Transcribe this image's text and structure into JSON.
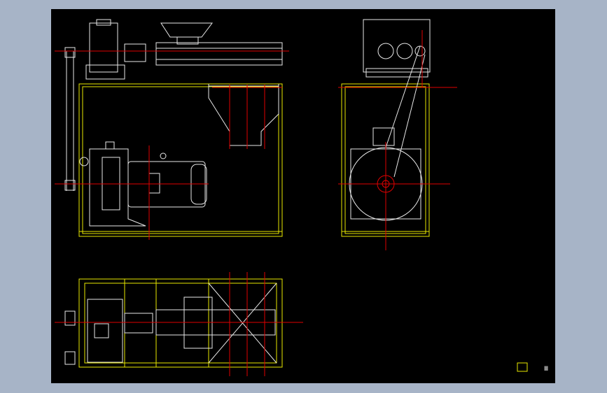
{
  "window": {
    "background_color": "#a7b4c7",
    "canvas_color": "#000000"
  },
  "colors": {
    "outline": "#e8e8e8",
    "frame": "#e8e800",
    "centerline": "#e00000",
    "annotation": "#ffffff"
  },
  "drawing": {
    "views": [
      {
        "name": "front-view"
      },
      {
        "name": "side-view"
      },
      {
        "name": "top-view"
      }
    ],
    "corner_text": "Ⅲ"
  }
}
